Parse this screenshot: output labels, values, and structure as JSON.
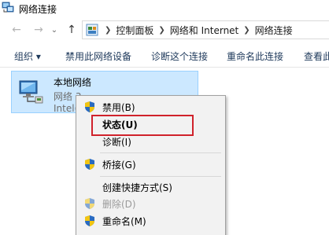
{
  "window": {
    "title": "网络连接"
  },
  "address": {
    "crumbs": [
      "控制面板",
      "网络和 Internet",
      "网络连接"
    ]
  },
  "toolbar": {
    "organize": "组织 ▾",
    "disable_device": "禁用此网络设备",
    "diagnose": "诊断这个连接",
    "rename": "重命名此连接",
    "view_status": "查看此"
  },
  "connection": {
    "name": "本地网络",
    "status": "网络 3",
    "device": "Intel("
  },
  "context_menu": {
    "items": [
      {
        "label": "禁用(B)",
        "shield": true,
        "bold": false,
        "disabled": false
      },
      {
        "label": "状态(U)",
        "shield": false,
        "bold": true,
        "disabled": false,
        "highlighted": true
      },
      {
        "label": "诊断(I)",
        "shield": false,
        "bold": false,
        "disabled": false
      },
      {
        "label": "桥接(G)",
        "shield": true,
        "bold": false,
        "disabled": false
      },
      {
        "label": "创建快捷方式(S)",
        "shield": false,
        "bold": false,
        "disabled": false
      },
      {
        "label": "删除(D)",
        "shield": true,
        "bold": false,
        "disabled": true
      },
      {
        "label": "重命名(M)",
        "shield": true,
        "bold": false,
        "disabled": false
      }
    ]
  },
  "colors": {
    "highlight_border": "#d0222b",
    "selection_bg": "#cce8ff"
  },
  "icons": [
    "network-connections-icon",
    "back-arrow-icon",
    "forward-arrow-icon",
    "up-arrow-icon",
    "control-panel-icon",
    "network-adapter-icon",
    "uac-shield-icon"
  ]
}
